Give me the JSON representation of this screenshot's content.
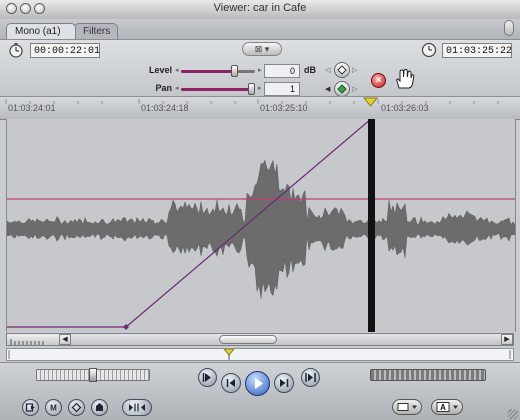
{
  "window": {
    "title": "Viewer: car in Cafe"
  },
  "tabs": [
    {
      "label": "Mono (a1)",
      "active": true
    },
    {
      "label": "Filters",
      "active": false
    }
  ],
  "timecodes": {
    "duration": "00:00:22:01",
    "current": "01:03:25:22"
  },
  "level": {
    "label": "Level",
    "value": "0",
    "unit": "dB",
    "slider_fraction": 0.72
  },
  "pan": {
    "label": "Pan",
    "value": "1",
    "slider_fraction": 0.95
  },
  "ruler": {
    "ticks": [
      "01:03:24:01",
      "01:03:24:18",
      "01:03:25:10",
      "01:03:26:03"
    ]
  },
  "colors": {
    "accent": "#8b2268",
    "level_line": "#c03d78",
    "playhead": "#111111",
    "waveform": "#6c6c6c",
    "playhead_marker": "#e4d13a"
  },
  "icons": {
    "duration_clock": "stopwatch-icon",
    "current_clock": "clock-icon",
    "reset": "close-icon",
    "drag_hand": "hand-icon"
  }
}
